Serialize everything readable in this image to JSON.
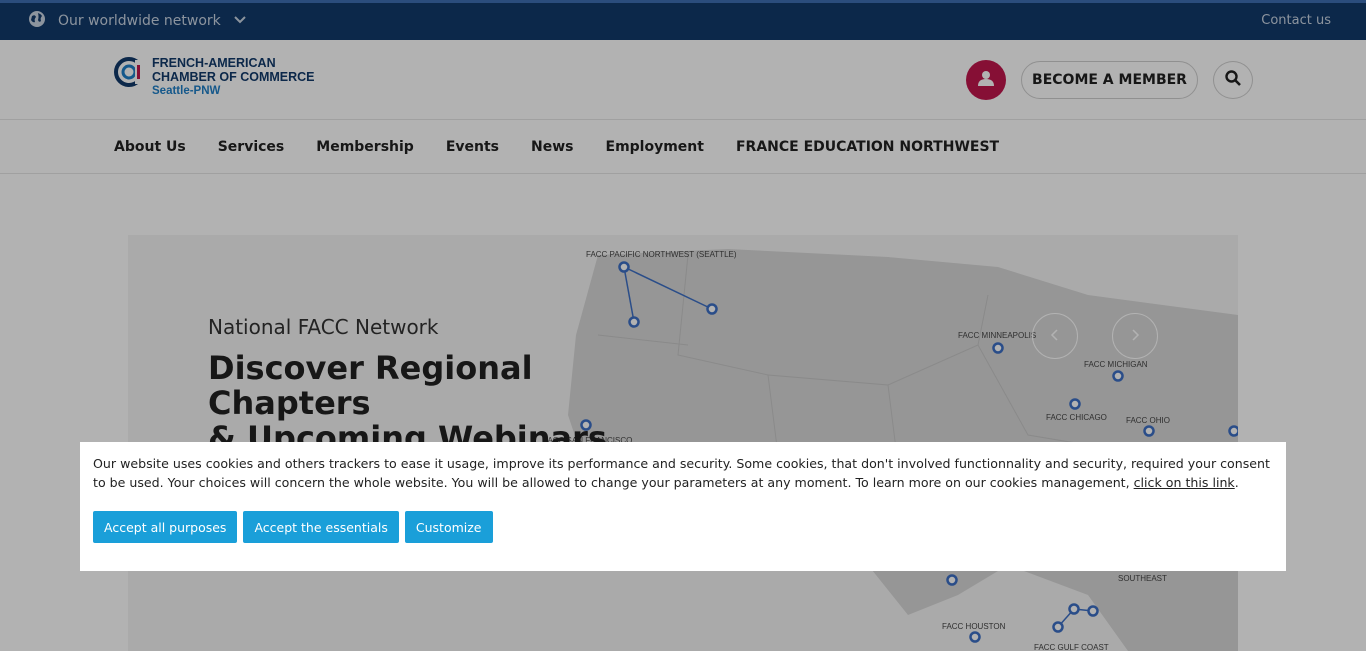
{
  "topbar": {
    "network_label": "Our worldwide network",
    "contact_label": "Contact us",
    "icons": [
      "globe-icon",
      "chevron-down-icon"
    ]
  },
  "header": {
    "logo": {
      "line1": "FRENCH-AMERICAN",
      "line2": "CHAMBER OF COMMERCE",
      "line3": "Seattle-PNW"
    },
    "become_member_label": "BECOME A MEMBER",
    "icons": [
      "user-icon",
      "search-icon"
    ]
  },
  "nav": {
    "items": [
      {
        "label": "About Us"
      },
      {
        "label": "Services"
      },
      {
        "label": "Membership"
      },
      {
        "label": "Events"
      },
      {
        "label": "News"
      },
      {
        "label": "Employment"
      },
      {
        "label": "FRANCE EDUCATION NORTHWEST"
      }
    ]
  },
  "hero": {
    "kicker": "National FACC Network",
    "title_line1": "Discover Regional Chapters",
    "title_line2": "& Upcoming Webinars",
    "map_labels": {
      "seattle": "FACC PACIFIC NORTHWEST (SEATTLE)",
      "minneapolis": "FACC MINNEAPOLIS",
      "michigan": "FACC MICHIGAN",
      "chicago": "FACC CHICAGO",
      "ohio": "FACC OHIO",
      "san_francisco": "FACC SAN FRANCISCO",
      "southeast": "SOUTHEAST",
      "houston": "FACC HOUSTON",
      "gulf_coast": "FACC GULF COAST"
    },
    "icons": [
      "chevron-left-icon",
      "chevron-right-icon"
    ]
  },
  "cookie_banner": {
    "message": "Our website uses cookies and others trackers to ease it usage, improve its performance and security. Some cookies, that don't involved functionnality and security, required your consent to be used. Your choices will concern the whole website. You will be allowed to change your parameters at any moment. To learn more on our cookies management, ",
    "link_label": "click on this link",
    "message_end": ".",
    "buttons": {
      "accept_all": "Accept all purposes",
      "accept_essentials": "Accept the essentials",
      "customize": "Customize"
    }
  },
  "colors": {
    "topbar": "#123a6b",
    "accent": "#1a9fd9",
    "user_button": "#c0164c",
    "map_land": "#d7d7d7",
    "map_marker": "#3d6fc4"
  }
}
